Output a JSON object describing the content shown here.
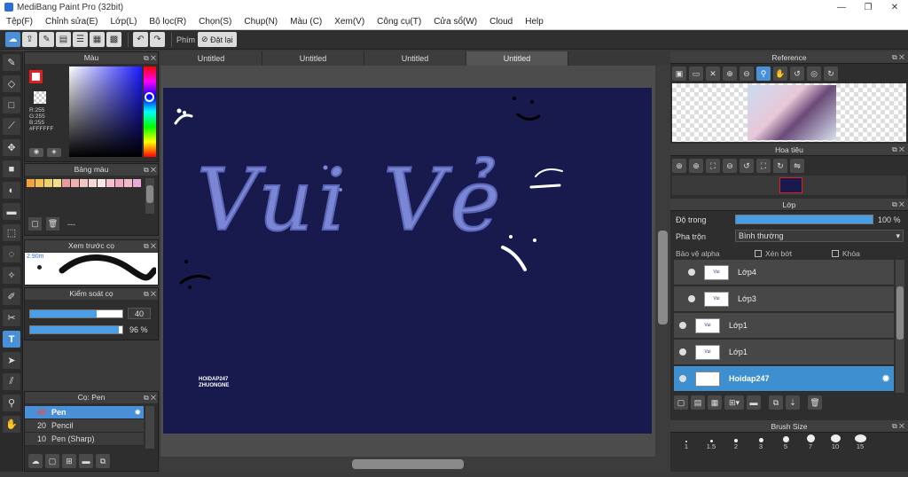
{
  "window": {
    "title": "MediBang Paint Pro (32bit)",
    "min": "—",
    "max": "❐",
    "close": "✕"
  },
  "menu": [
    "Tệp(F)",
    "Chỉnh sửa(E)",
    "Lớp(L)",
    "Bộ lọc(R)",
    "Chọn(S)",
    "Chụp(N)",
    "Màu (C)",
    "Xem(V)",
    "Công cụ(T)",
    "Cửa sổ(W)",
    "Cloud",
    "Help"
  ],
  "toolbar": {
    "shortcut_label": "Phím",
    "reset_label": "Đặt lại"
  },
  "color_panel": {
    "title": "Màu",
    "r": "R:255",
    "g": "G:255",
    "b": "B:255",
    "hex": "#FFFFFF"
  },
  "palette_panel": {
    "title": "Bảng màu",
    "dash": "---",
    "colors": [
      "#f2a33a",
      "#f2c14e",
      "#f0d26a",
      "#f4e08a",
      "#e89a9a",
      "#f0b0b0",
      "#f4c6c6",
      "#f7d8d8",
      "#fbe6e6",
      "#f6c0d0",
      "#f0a8c0",
      "#f4b8c8",
      "#e8a8d8"
    ]
  },
  "preview_panel": {
    "title": "Xem trước cọ",
    "size": "2.90m"
  },
  "brush_control": {
    "title": "Kiểm soát cọ",
    "size_value": "40",
    "opacity_value": "96 %",
    "size_fill": 0.72,
    "opacity_fill": 0.96
  },
  "brush_panel": {
    "title": "Cọ: Pen",
    "items": [
      {
        "size": "40",
        "name": "Pen"
      },
      {
        "size": "20",
        "name": "Pencil"
      },
      {
        "size": "10",
        "name": "Pen (Sharp)"
      }
    ]
  },
  "tabs": [
    "Untitled",
    "Untitled",
    "Untitled",
    "Untitled"
  ],
  "canvas": {
    "title_text": "Vui Vẻ",
    "credit_line1": "HOIDAP247",
    "credit_line2": "ZHUONGNE"
  },
  "reference_panel": {
    "title": "Reference"
  },
  "navigator_panel": {
    "title": "Hoa tiêu"
  },
  "layer_panel": {
    "title": "Lớp",
    "opacity_label": "Độ trong",
    "opacity_value": "100 %",
    "opacity_fill": 1.0,
    "blend_label": "Pha trộn",
    "blend_value": "Bình thường",
    "protect_alpha": "Bảo vệ alpha",
    "clipping": "Xén bớt",
    "lock": "Khóa",
    "layers": [
      "Lớp4",
      "Lớp3",
      "Lớp1",
      "Lớp1",
      "Hoidap247"
    ]
  },
  "brush_size_panel": {
    "title": "Brush Size",
    "sizes": [
      "1",
      "1.5",
      "2",
      "3",
      "5",
      "7",
      "10",
      "15"
    ]
  },
  "colors": {
    "accent": "#4a90d9",
    "canvas_bg": "#181a4d",
    "lettering": "#7b86d4"
  }
}
